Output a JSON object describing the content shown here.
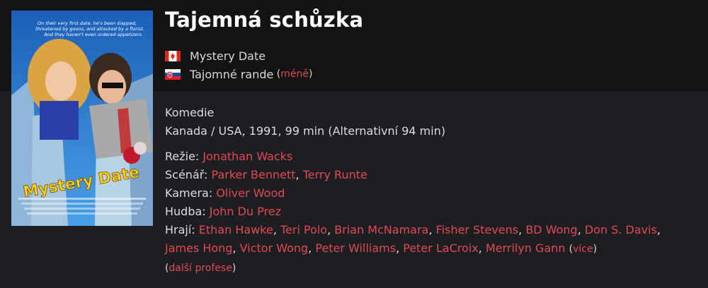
{
  "title": "Tajemná schůzka",
  "alt_titles": [
    {
      "flag": "canada-flag-icon",
      "name": "Mystery Date"
    },
    {
      "flag": "slovakia-flag-icon",
      "name": "Tajomné rande"
    }
  ],
  "less_link": "méně",
  "genre": "Komedie",
  "origin": "Kanada / USA, 1991, 99 min (Alternativní 94 min)",
  "credits": {
    "director_label": "Režie:",
    "directors": [
      "Jonathan Wacks"
    ],
    "writer_label": "Scénář:",
    "writers": [
      "Parker Bennett",
      "Terry Runte"
    ],
    "camera_label": "Kamera:",
    "camera": [
      "Oliver Wood"
    ],
    "music_label": "Hudba:",
    "music": [
      "John Du Prez"
    ],
    "cast_label": "Hrají:",
    "cast": [
      "Ethan Hawke",
      "Teri Polo",
      "Brian McNamara",
      "Fisher Stevens",
      "BD Wong",
      "Don S. Davis",
      "James Hong",
      "Victor Wong",
      "Peter Williams",
      "Peter LaCroix",
      "Merrilyn Gann"
    ],
    "more_link": "více",
    "more_professions": "další profese"
  },
  "poster": {
    "tagline": "On their very first date, he's been slapped, threatened by goons, and attacked by a florist. And they haven't even ordered appetizers.",
    "logo_text": "Mystery Date"
  },
  "colors": {
    "background": "#1d1e21",
    "header_band": "#121315",
    "link": "#e04a54"
  }
}
